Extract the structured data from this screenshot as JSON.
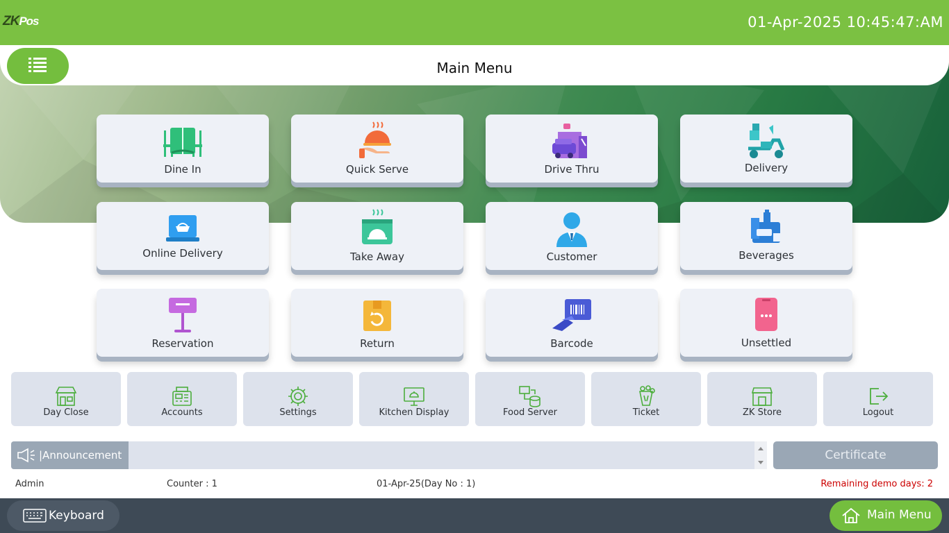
{
  "header": {
    "logo_main": "ZK",
    "logo_sub": "Pos",
    "datetime": "01-Apr-2025 10:45:47:AM"
  },
  "title": "Main Menu",
  "tiles": [
    {
      "label": "Dine In",
      "icon": "dine-in-icon"
    },
    {
      "label": "Quick Serve",
      "icon": "quick-serve-icon"
    },
    {
      "label": "Drive Thru",
      "icon": "drive-thru-icon"
    },
    {
      "label": "Delivery",
      "icon": "delivery-icon"
    },
    {
      "label": "Online Delivery",
      "icon": "online-delivery-icon"
    },
    {
      "label": "Take Away",
      "icon": "take-away-icon"
    },
    {
      "label": "Customer",
      "icon": "customer-icon"
    },
    {
      "label": "Beverages",
      "icon": "beverages-icon"
    },
    {
      "label": "Reservation",
      "icon": "reservation-icon"
    },
    {
      "label": "Return",
      "icon": "return-icon"
    },
    {
      "label": "Barcode",
      "icon": "barcode-icon"
    },
    {
      "label": "Unsettled",
      "icon": "unsettled-icon"
    }
  ],
  "functions": [
    {
      "label": "Day Close",
      "icon": "shop-icon"
    },
    {
      "label": "Accounts",
      "icon": "accounts-icon"
    },
    {
      "label": "Settings",
      "icon": "gear-icon"
    },
    {
      "label": "Kitchen Display",
      "icon": "kitchen-display-icon"
    },
    {
      "label": "Food Server",
      "icon": "food-server-icon"
    },
    {
      "label": "Ticket",
      "icon": "ticket-icon"
    },
    {
      "label": "ZK Store",
      "icon": "store-icon"
    },
    {
      "label": "Logout",
      "icon": "logout-icon"
    }
  ],
  "announcement": {
    "label": "|Announcement"
  },
  "certificate": "Certificate",
  "status": {
    "user": "Admin",
    "counter": "Counter : 1",
    "date": "01-Apr-25(Day No : 1)",
    "demo": "Remaining demo days: 2"
  },
  "footer": {
    "keyboard": "Keyboard",
    "main_menu": "Main Menu"
  },
  "colors": {
    "accent": "#7bc142",
    "tile": "#eef1f7",
    "footer": "#3e4a56",
    "demo_text": "#cc0000"
  }
}
